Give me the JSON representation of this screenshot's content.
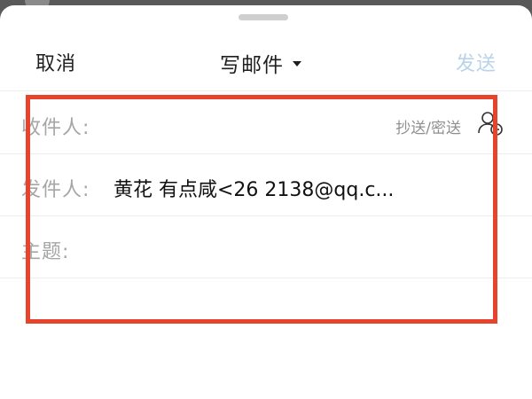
{
  "header": {
    "cancel_label": "取消",
    "title": "写邮件",
    "send_label": "发送"
  },
  "fields": {
    "to": {
      "label": "收件人:",
      "cc_bcc_label": "抄送/密送",
      "value": ""
    },
    "from": {
      "label": "发件人:",
      "value": "黄花⁠     有点咸<26          2138@qq.c..."
    },
    "subject": {
      "label": "主题:",
      "value": ""
    }
  },
  "colors": {
    "accent_disabled": "#b9d3ea",
    "highlight": "#e8432d"
  },
  "icons": {
    "contact": "add-contact-icon",
    "title_caret": "caret-down-icon"
  }
}
